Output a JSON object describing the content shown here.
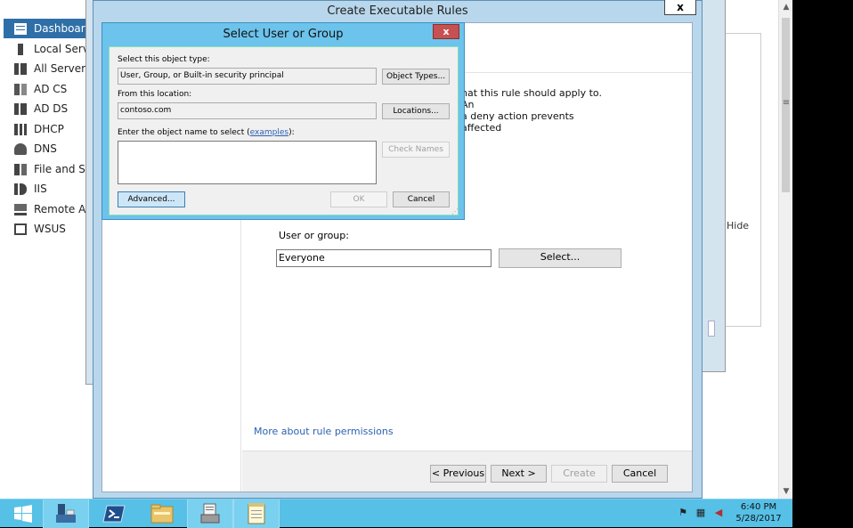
{
  "sidebar": {
    "items": [
      {
        "label": "Dashboard",
        "icon": "dashboard-icon",
        "selected": true
      },
      {
        "label": "Local Serve",
        "icon": "local-server-icon"
      },
      {
        "label": "All Servers",
        "icon": "all-servers-icon"
      },
      {
        "label": "AD CS",
        "icon": "ad-cs-icon"
      },
      {
        "label": "AD DS",
        "icon": "ad-ds-icon"
      },
      {
        "label": "DHCP",
        "icon": "dhcp-icon"
      },
      {
        "label": "DNS",
        "icon": "dns-icon"
      },
      {
        "label": "File and Sto",
        "icon": "file-storage-icon"
      },
      {
        "label": "IIS",
        "icon": "iis-icon"
      },
      {
        "label": "Remote Ac",
        "icon": "remote-access-icon"
      },
      {
        "label": "WSUS",
        "icon": "wsus-icon"
      }
    ]
  },
  "wizard": {
    "title": "Create Executable Rules",
    "close": "x",
    "text_line1": "hat this rule should apply to. An",
    "text_line2": "a deny action prevents affected",
    "user_group_label": "User or group:",
    "user_group_value": "Everyone",
    "select_button": "Select...",
    "more_link": "More about rule permissions",
    "buttons": {
      "previous": "< Previous",
      "next": "Next >",
      "create": "Create",
      "cancel": "Cancel"
    }
  },
  "behind": {
    "hide_label": "Hide"
  },
  "dialog": {
    "title": "Select User or Group",
    "close": "x",
    "object_type_label": "Select this object type:",
    "object_type_value": "User, Group, or Built-in security principal",
    "object_types_button": "Object Types...",
    "location_label": "From this location:",
    "location_value": "contoso.com",
    "locations_button": "Locations...",
    "enter_label_prefix": "Enter the object name to select (",
    "enter_label_link": "examples",
    "enter_label_suffix": "):",
    "object_name_value": "",
    "check_names_button": "Check Names",
    "advanced_button": "Advanced...",
    "ok_button": "OK",
    "cancel_button": "Cancel"
  },
  "taskbar": {
    "apps": [
      {
        "name": "start",
        "icon": "windows-logo-icon"
      },
      {
        "name": "server-manager",
        "icon": "server-manager-icon",
        "active": true
      },
      {
        "name": "powershell",
        "icon": "powershell-icon"
      },
      {
        "name": "file-explorer",
        "icon": "folder-icon"
      },
      {
        "name": "printer-doc",
        "icon": "document-printer-icon",
        "active": true
      },
      {
        "name": "notepad",
        "icon": "notepad-icon",
        "active": true
      }
    ],
    "time": "6:40 PM",
    "date": "5/28/2017"
  },
  "colors": {
    "taskbar": "#56c0e6",
    "dialog_frame": "#6cc3ec",
    "selection": "#2f6fa8",
    "link": "#2b61b3",
    "dialog_close": "#c75050"
  }
}
